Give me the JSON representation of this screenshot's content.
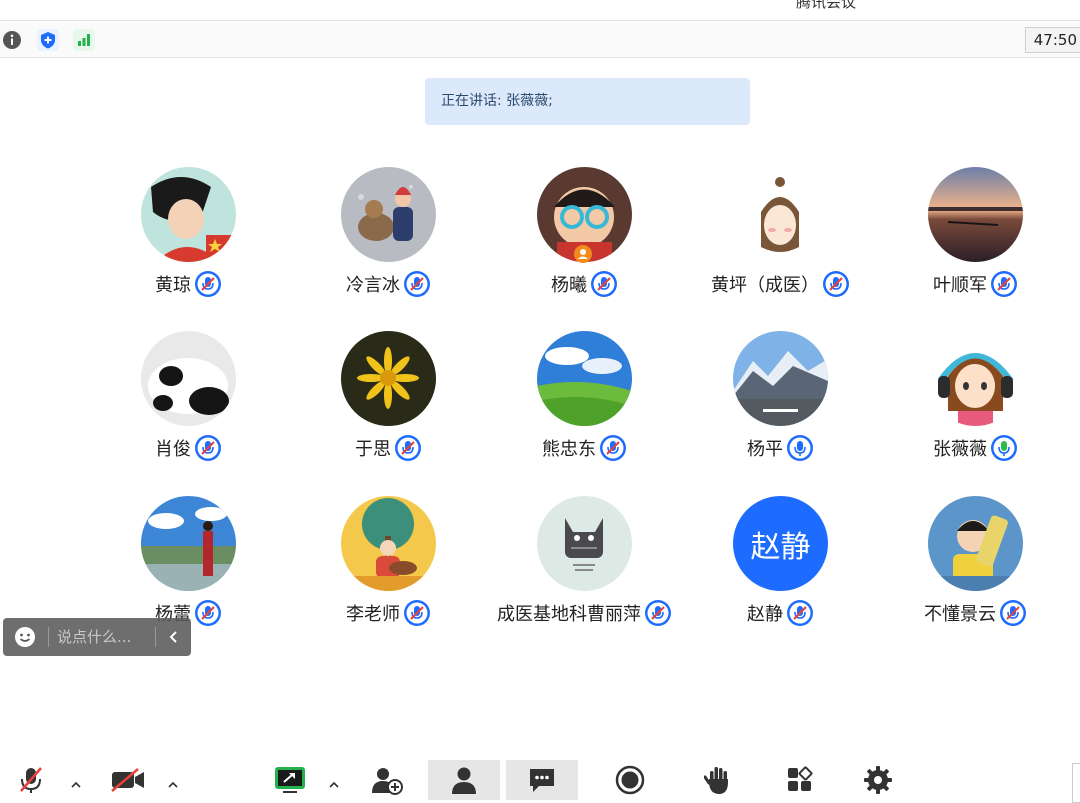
{
  "app": {
    "title": "腾讯会议"
  },
  "topbar": {
    "info_icon": "info-icon",
    "security_icon": "shield-icon",
    "signal_icon": "signal-icon",
    "timer": "47:50"
  },
  "speaking": {
    "text": "正在讲话: 张薇薇;"
  },
  "participants": [
    {
      "name": "黄琼",
      "mic": "muted"
    },
    {
      "name": "冷言冰",
      "mic": "muted"
    },
    {
      "name": "杨曦",
      "mic": "muted",
      "host_badge": true
    },
    {
      "name": "黄坪（成医）",
      "mic": "muted"
    },
    {
      "name": "叶顺军",
      "mic": "muted"
    },
    {
      "name": "肖俊",
      "mic": "muted"
    },
    {
      "name": "于思",
      "mic": "muted"
    },
    {
      "name": "熊忠东",
      "mic": "muted"
    },
    {
      "name": "杨平",
      "mic": "on"
    },
    {
      "name": "张薇薇",
      "mic": "speaking"
    },
    {
      "name": "杨蕾",
      "mic": "muted"
    },
    {
      "name": "李老师",
      "mic": "muted"
    },
    {
      "name": "成医基地科曹丽萍",
      "mic": "muted"
    },
    {
      "name": "赵静",
      "mic": "muted",
      "avatar_text": "赵静"
    },
    {
      "name": "不懂景云",
      "mic": "muted"
    }
  ],
  "chat": {
    "placeholder": "说点什么...",
    "emoji_icon": "emoji-icon",
    "collapse_icon": "chevron-left-icon"
  },
  "toolbar": {
    "items": [
      "mute-mic-icon",
      "stop-video-icon",
      "share-screen-icon",
      "invite-icon",
      "participants-icon",
      "chat-icon",
      "record-icon",
      "raise-hand-icon",
      "apps-icon",
      "settings-icon"
    ]
  },
  "colors": {
    "accent": "#1e6cff",
    "speaking": "#2ab94b",
    "muted_red": "#e8413c",
    "banner": "#dbe9fa"
  }
}
